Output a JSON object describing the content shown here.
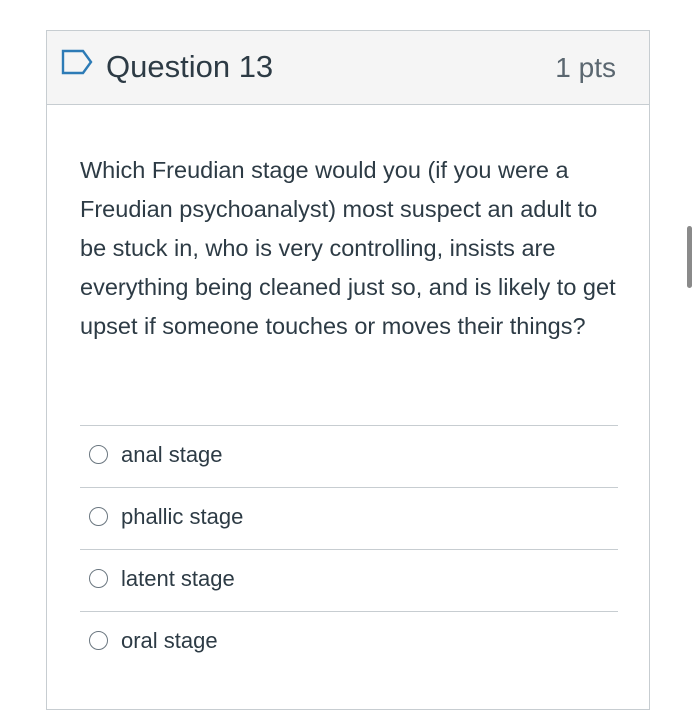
{
  "question": {
    "title": "Question 13",
    "points": "1 pts",
    "text": "Which Freudian stage would you (if you were a Freudian psychoanalyst) most suspect an adult to be stuck in, who is very controlling, insists are everything being cleaned just so, and is likely to get upset if someone touches or moves their things?",
    "answers": [
      {
        "label": "anal stage",
        "selected": false
      },
      {
        "label": "phallic stage",
        "selected": false
      },
      {
        "label": "latent stage",
        "selected": false
      },
      {
        "label": "oral stage",
        "selected": false
      }
    ]
  },
  "icons": {
    "flag": "flag-icon"
  },
  "colors": {
    "header_bg": "#f5f5f5",
    "border": "#c7cdd1",
    "text": "#2d3b45",
    "flag": "#2d7bb6"
  }
}
